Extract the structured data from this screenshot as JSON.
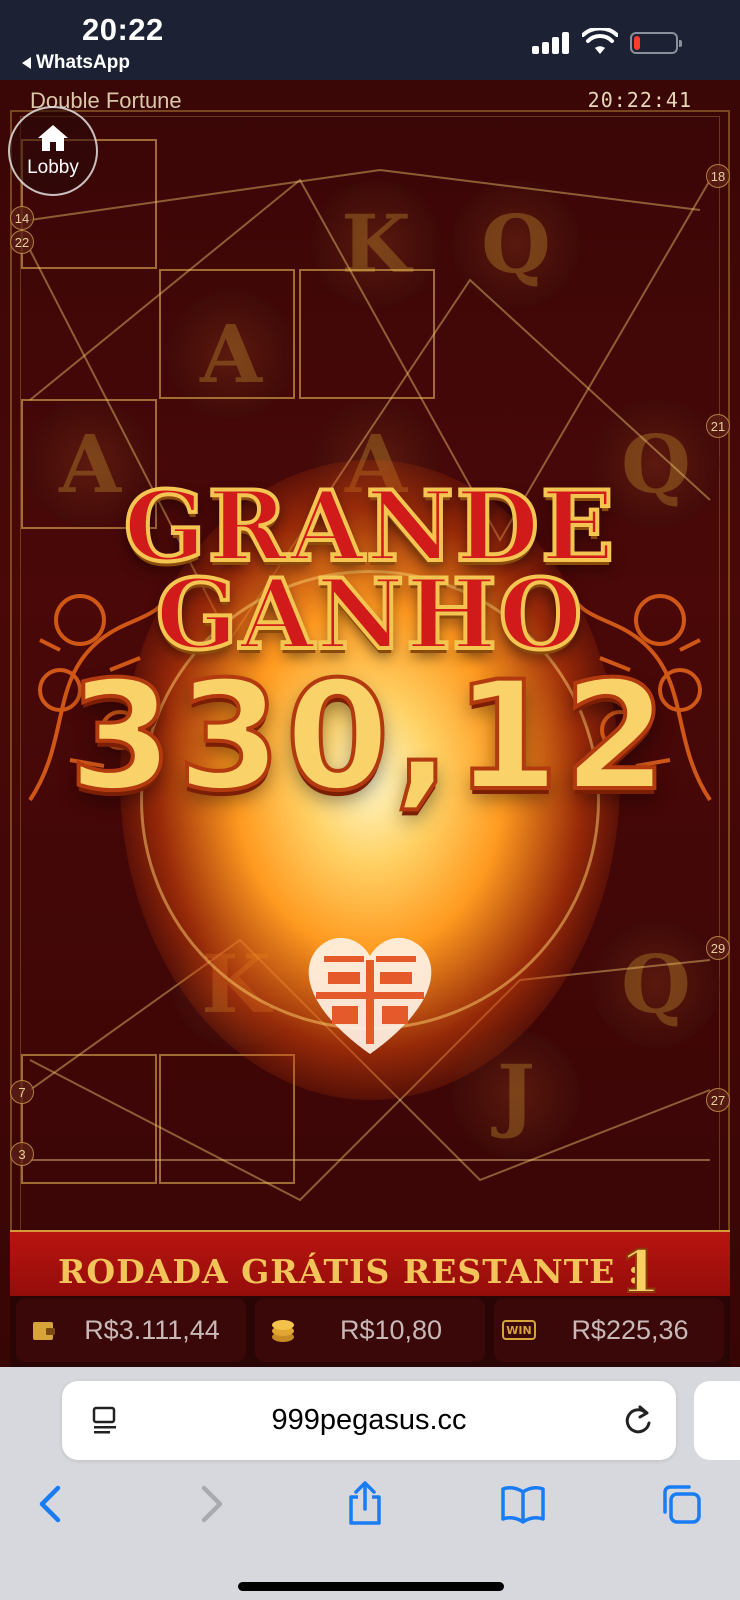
{
  "status_bar": {
    "time": "20:22",
    "back_app": "WhatsApp",
    "battery_percent": 15,
    "signal_bars": 4
  },
  "game": {
    "title": "Double Fortune",
    "clock": "20:22:41",
    "lobby_label": "Lobby",
    "payline_numbers": {
      "left_top": "14",
      "left_top2": "22",
      "left_bottom": "7",
      "left_bottom2": "3",
      "right_top": "18",
      "right_mid": "21",
      "right_low": "29",
      "right_bottom": "27"
    },
    "symbols": [
      "A",
      "K",
      "Q",
      "A",
      "A",
      "Q",
      "K",
      "Q",
      "J"
    ],
    "big_win_line1": "GRANDE",
    "big_win_line2": "GANHO",
    "win_amount": "330,12",
    "free_spins_label": "RODADA GRÁTIS RESTANTE :",
    "free_spins_count": "1",
    "meters": {
      "balance": "R$3.111,44",
      "bet": "R$10,80",
      "win": "R$225,36",
      "win_icon_text": "WIN"
    },
    "colors": {
      "accent_gold": "#f5c552",
      "win_red": "#d11a1a",
      "background": "#3a0606"
    }
  },
  "browser": {
    "url": "999pegasus.cc",
    "icons": [
      "page-menu-icon",
      "reload-icon",
      "back-icon",
      "forward-icon",
      "share-icon",
      "bookmarks-icon",
      "tabs-icon"
    ]
  }
}
